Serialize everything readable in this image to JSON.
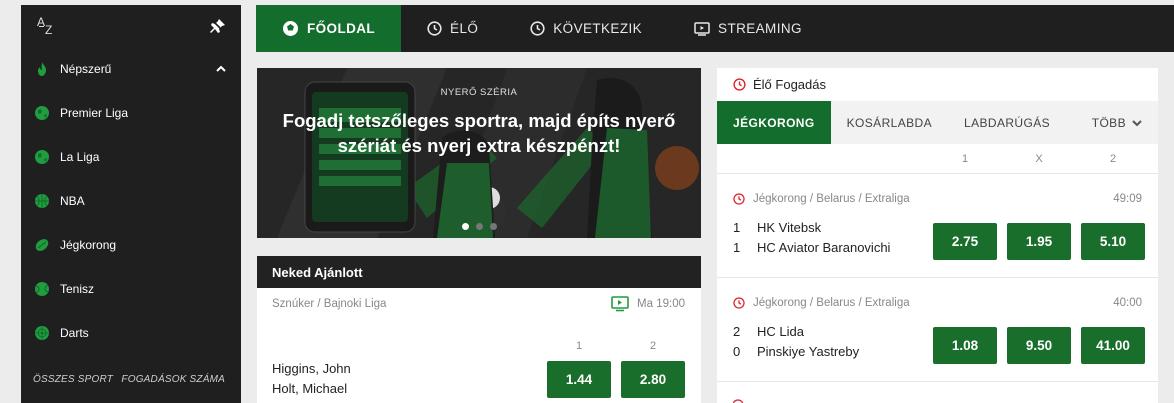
{
  "sidebar": {
    "az_label_a": "A",
    "az_label_z": "Z",
    "items": [
      {
        "label": "Népszerű",
        "icon": "flame-icon",
        "color": "#1f9d3f"
      },
      {
        "label": "Premier Liga",
        "icon": "globe-icon",
        "color": "#1f9d3f"
      },
      {
        "label": "La Liga",
        "icon": "globe-icon",
        "color": "#1f9d3f"
      },
      {
        "label": "NBA",
        "icon": "basketball-icon",
        "color": "#1f9d3f"
      },
      {
        "label": "Jégkorong",
        "icon": "hockey-puck-icon",
        "color": "#1f9d3f"
      },
      {
        "label": "Tenisz",
        "icon": "tennis-ball-icon",
        "color": "#1f9d3f"
      },
      {
        "label": "Darts",
        "icon": "dartboard-icon",
        "color": "#1f9d3f"
      }
    ],
    "footer": {
      "all_sports": "ÖSSZES SPORT",
      "bet_count": "FOGADÁSOK SZÁMA"
    }
  },
  "topnav": {
    "tabs": [
      {
        "label": "FŐOLDAL",
        "icon": "home-ball-icon",
        "active": true
      },
      {
        "label": "ÉLŐ",
        "icon": "clock-icon",
        "active": false
      },
      {
        "label": "KÖVETKEZIK",
        "icon": "clock-icon",
        "active": false
      },
      {
        "label": "STREAMING",
        "icon": "tv-icon",
        "active": false
      }
    ]
  },
  "banner": {
    "kicker": "NYERŐ SZÉRIA",
    "headline": "Fogadj tetszőleges sportra, majd építs nyerő szériát és nyerj extra készpénzt!",
    "slide_count": 3,
    "active_slide": 0
  },
  "recommended": {
    "title": "Neked Ajánlott",
    "league": "Sznúker / Bajnoki Liga",
    "time": "Ma 19:00",
    "col_1": "1",
    "col_2": "2",
    "team_1": "Higgins, John",
    "team_2": "Holt, Michael",
    "odd_1": "1.44",
    "odd_2": "2.80"
  },
  "live": {
    "title": "Élő Fogadás",
    "sport_tabs": [
      "JÉGKORONG",
      "KOSÁRLABDA",
      "LABDARÚGÁS"
    ],
    "more": "TÖBB",
    "cols": [
      "1",
      "X",
      "2"
    ],
    "matches": [
      {
        "league": "Jégkorong / Belarus / Extraliga",
        "time": "49:09",
        "home_score": "1",
        "home": "HK Vitebsk",
        "away_score": "1",
        "away": "HC Aviator Baranovichi",
        "odds": [
          "2.75",
          "1.95",
          "5.10"
        ]
      },
      {
        "league": "Jégkorong / Belarus / Extraliga",
        "time": "40:00",
        "home_score": "2",
        "home": "HC Lida",
        "away_score": "0",
        "away": "Pinskiye Yastreby",
        "odds": [
          "1.08",
          "9.50",
          "41.00"
        ]
      }
    ]
  },
  "colors": {
    "brand_green": "#136d2d",
    "odd_green": "#1a6e2b",
    "dark": "#1f1f1f",
    "accent_red": "#d9262d"
  }
}
